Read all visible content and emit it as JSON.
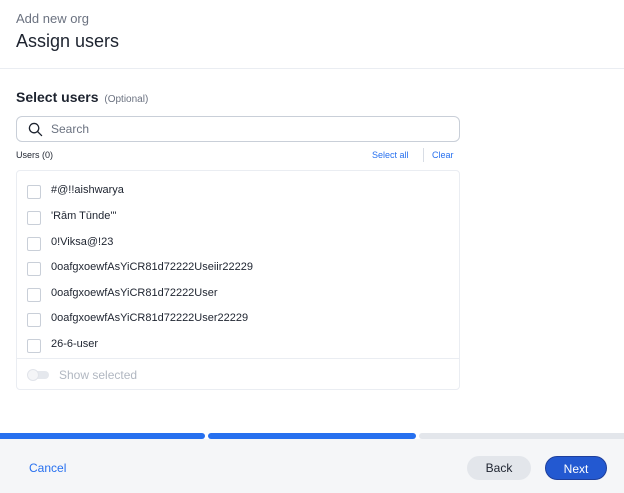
{
  "header": {
    "eyebrow": "Add new org",
    "title": "Assign users"
  },
  "section": {
    "label": "Select users",
    "optional": "(Optional)"
  },
  "search": {
    "placeholder": "Search",
    "value": "",
    "icon": "search-icon"
  },
  "users": {
    "count_label": "Users (0)",
    "select_all": "Select all",
    "clear": "Clear",
    "items": [
      {
        "label": "#@!!aishwarya",
        "checked": false
      },
      {
        "label": "'Rām Tūnde'\"",
        "checked": false
      },
      {
        "label": "0!Viksa@!23",
        "checked": false
      },
      {
        "label": "0oafgxoewfAsYiCR81d72222Useiir22229",
        "checked": false
      },
      {
        "label": "0oafgxoewfAsYiCR81d72222User",
        "checked": false
      },
      {
        "label": "0oafgxoewfAsYiCR81d72222User22229",
        "checked": false
      },
      {
        "label": "26-6-user",
        "checked": false
      }
    ],
    "show_selected_label": "Show selected",
    "show_selected_on": false
  },
  "progress": {
    "steps_total": 3,
    "steps_completed": 2
  },
  "footer": {
    "cancel_label": "Cancel",
    "back_label": "Back",
    "next_label": "Next"
  },
  "colors": {
    "accent": "#2770ef",
    "primary_button": "#2359d1",
    "text": "#1d232f",
    "muted": "#6b7280"
  }
}
